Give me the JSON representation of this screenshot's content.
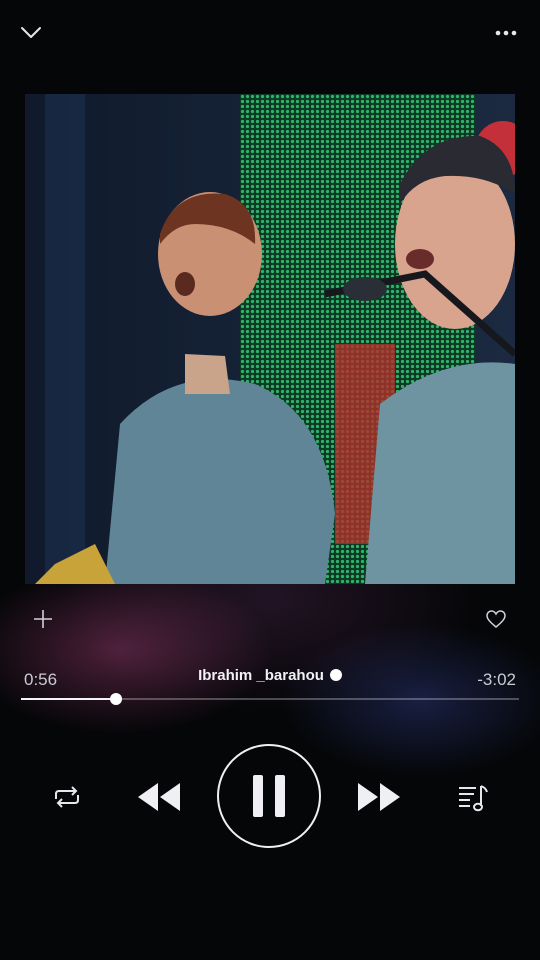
{
  "player": {
    "artist": "Ibrahim _barahou",
    "time_elapsed": "0:56",
    "time_remaining": "-3:02",
    "progress": 0.19,
    "state": "playing"
  },
  "icons": {
    "collapse": "chevron-down-icon",
    "more": "more-dots-icon",
    "add": "plus-icon",
    "favorite": "heart-outline-icon",
    "repeat": "repeat-icon",
    "previous": "rewind-icon",
    "pause": "pause-icon",
    "next": "fast-forward-icon",
    "queue": "playlist-icon"
  },
  "colors": {
    "background": "#050608",
    "foreground": "#f0f0f4",
    "track_inactive": "#5a5b60"
  }
}
